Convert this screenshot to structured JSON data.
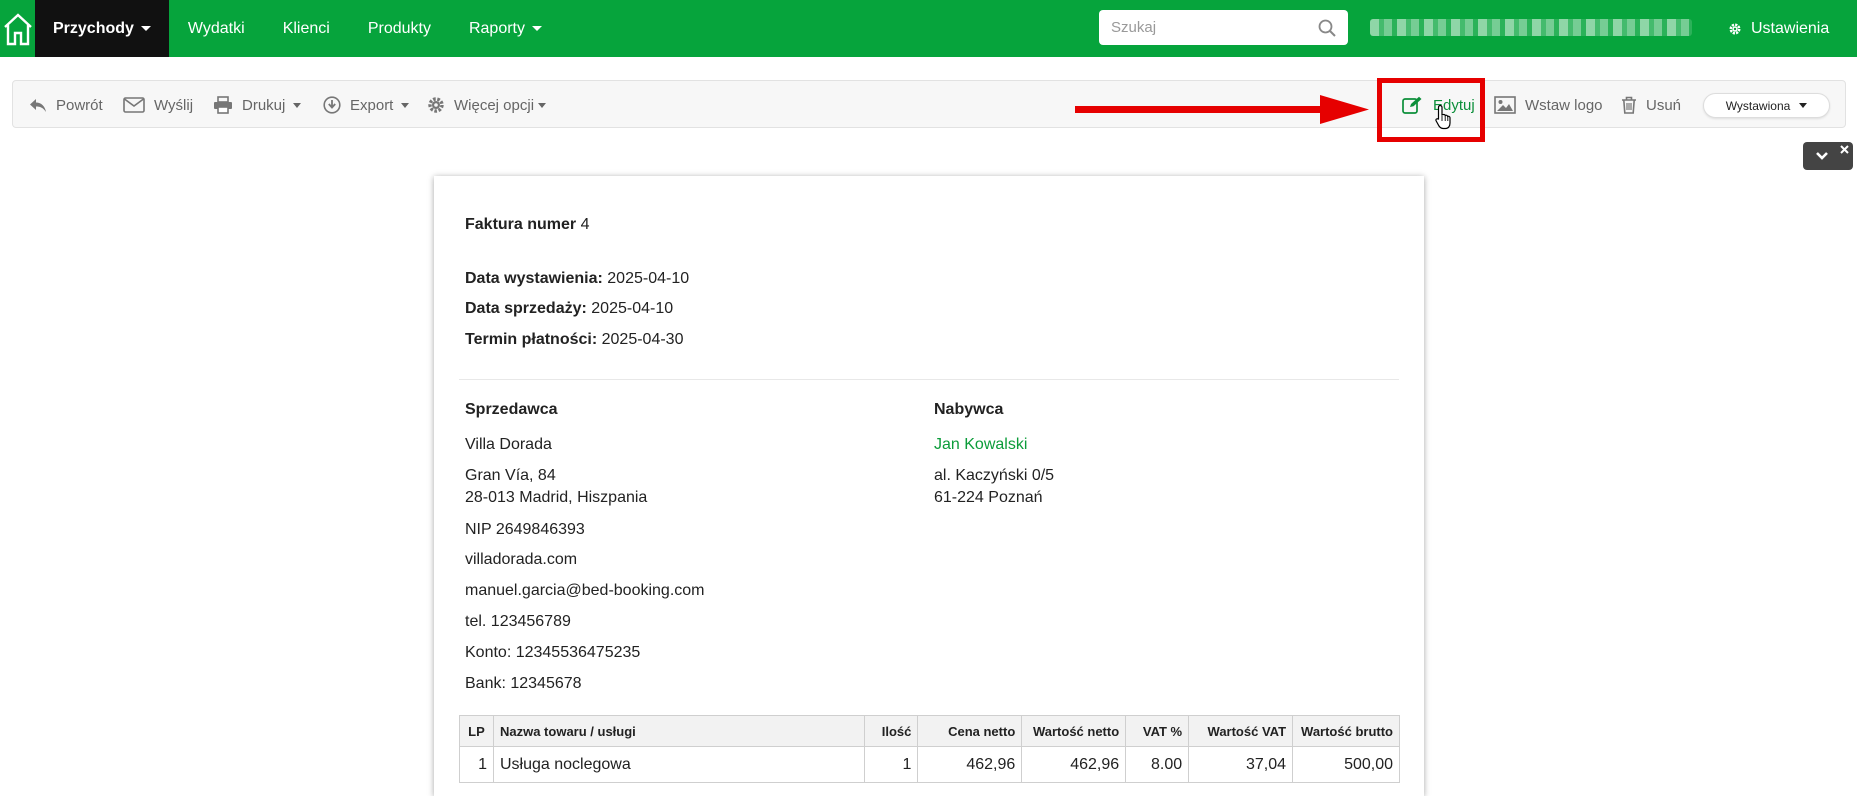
{
  "nav": {
    "items": [
      {
        "label": "Przychody",
        "active": true,
        "dropdown": true
      },
      {
        "label": "Wydatki",
        "active": false,
        "dropdown": false
      },
      {
        "label": "Klienci",
        "active": false,
        "dropdown": false
      },
      {
        "label": "Produkty",
        "active": false,
        "dropdown": false
      },
      {
        "label": "Raporty",
        "active": false,
        "dropdown": true
      }
    ],
    "search_placeholder": "Szukaj",
    "settings_label": "Ustawienia"
  },
  "toolbar": {
    "back": "Powrót",
    "send": "Wyślij",
    "print": "Drukuj",
    "export": "Export",
    "more": "Więcej opcji",
    "edit": "Edytuj",
    "insert_logo": "Wstaw logo",
    "delete": "Usuń",
    "status": "Wystawiona"
  },
  "invoice": {
    "title_label": "Faktura numer",
    "number": "4",
    "issue_date_label": "Data wystawienia:",
    "issue_date": "2025-04-10",
    "sale_date_label": "Data sprzedaży:",
    "sale_date": "2025-04-10",
    "due_date_label": "Termin płatności:",
    "due_date": "2025-04-30",
    "seller": {
      "heading": "Sprzedawca",
      "name": "Villa Dorada",
      "street": "Gran Vía, 84",
      "city": "28-013 Madrid, Hiszpania",
      "nip": "NIP 2649846393",
      "website": "villadorada.com",
      "email": "manuel.garcia@bed-booking.com",
      "phone": "tel. 123456789",
      "account": "Konto: 12345536475235",
      "bank": "Bank: 12345678"
    },
    "buyer": {
      "heading": "Nabywca",
      "name": "Jan Kowalski",
      "street": "al. Kaczyński 0/5",
      "city": "61-224 Poznań"
    },
    "table": {
      "headers": [
        "LP",
        "Nazwa towaru / usługi",
        "Ilość",
        "Cena netto",
        "Wartość netto",
        "VAT %",
        "Wartość VAT",
        "Wartość brutto"
      ],
      "rows": [
        {
          "lp": "1",
          "name": "Usługa noclegowa",
          "qty": "1",
          "net_price": "462,96",
          "net_value": "462,96",
          "vat_rate": "8.00",
          "vat_value": "37,04",
          "gross_value": "500,00"
        }
      ]
    }
  },
  "colors": {
    "brand_green": "#06a43c",
    "link_green": "#0c9c3a",
    "annotation_red": "#e60000"
  }
}
